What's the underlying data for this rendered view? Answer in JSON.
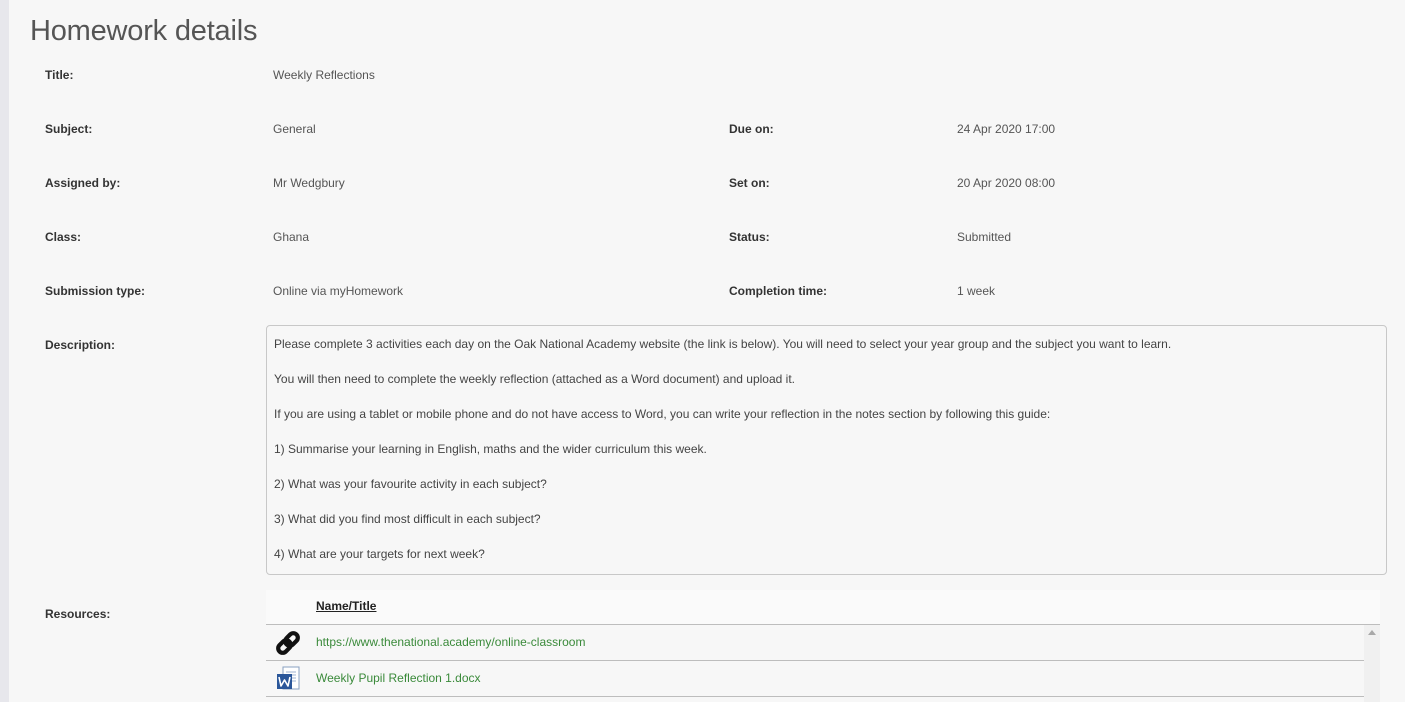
{
  "page": {
    "title": "Homework details"
  },
  "fields": {
    "title": {
      "label": "Title:",
      "value": "Weekly Reflections"
    },
    "subject": {
      "label": "Subject:",
      "value": "General"
    },
    "assigned_by": {
      "label": "Assigned by:",
      "value": "Mr Wedgbury"
    },
    "class": {
      "label": "Class:",
      "value": "Ghana"
    },
    "submission_type": {
      "label": "Submission type:",
      "value": "Online via myHomework"
    },
    "due_on": {
      "label": "Due on:",
      "value": "24 Apr 2020 17:00"
    },
    "set_on": {
      "label": "Set on:",
      "value": "20 Apr 2020 08:00"
    },
    "status": {
      "label": "Status:",
      "value": "Submitted"
    },
    "completion_time": {
      "label": "Completion time:",
      "value": "1 week"
    },
    "description": {
      "label": "Description:",
      "lines": [
        "Please complete 3 activities each day on the Oak National Academy website (the link is below). You will need to select your year group and the subject you want to learn.",
        "You will then need to complete the weekly reflection (attached as a Word document) and upload it.",
        "If you are using a tablet or mobile phone and do not have access to Word, you can write your reflection in the notes section by following this guide:",
        "1) Summarise your learning in English, maths and the wider curriculum this week.",
        "2) What was your favourite activity in each subject?",
        "3) What did you find most difficult in each subject?",
        "4) What are your targets for next week?"
      ]
    },
    "resources": {
      "label": "Resources:",
      "column_header": "Name/Title",
      "items": [
        {
          "icon": "link-icon",
          "name": "https://www.thenational.academy/online-classroom"
        },
        {
          "icon": "word-document-icon",
          "name": "Weekly Pupil Reflection 1.docx"
        }
      ]
    }
  },
  "colors": {
    "link": "#3a8a3a",
    "label": "#333333",
    "value": "#555555",
    "background": "#f7f7f7",
    "word_blue": "#2b579a"
  }
}
